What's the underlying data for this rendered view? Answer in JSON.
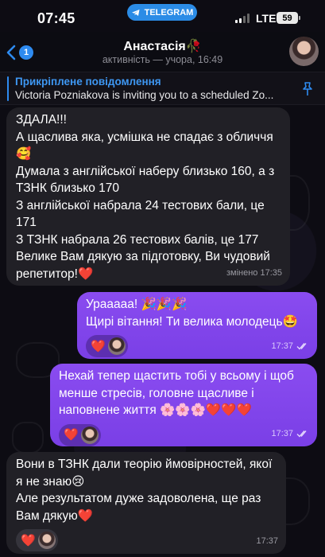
{
  "status_bar": {
    "time": "07:45",
    "app_pill": "TELEGRAM",
    "network": "LTE",
    "battery": "59"
  },
  "header": {
    "back_count": "1",
    "title": "Анастасія🥀",
    "subtitle": "активність — учора, 16:49"
  },
  "pinned": {
    "title": "Прикріплене повідомлення",
    "text": "Victoria Pozniakova is inviting you to a scheduled Zo..."
  },
  "messages": [
    {
      "direction": "incoming",
      "text": "ЗДАЛА!!!\nА щаслива яка, усмішка не спадає з обличчя🥰\nДумала з англійської наберу близько 160, а з ТЗНК близько 170\nЗ англійської набрала 24 тестових бали, це 171\nЗ ТЗНК набрала 26 тестових балів, це 177\nВелике Вам дякую за підготовку, Ви чудовий репетитор!❤️",
      "meta": "змінено 17:35"
    },
    {
      "direction": "outgoing",
      "text": "Урааааа! 🎉🎉🎉\nЩирі вітання! Ти велика молодець🤩",
      "meta": "17:37",
      "reaction": "❤️"
    },
    {
      "direction": "outgoing",
      "text": "Нехай тепер щастить тобі у всьому і щоб менше стресів, головне щасливе і наповнене життя 🌸🌸🌸❤️❤️❤️",
      "meta": "17:37",
      "reaction": "❤️"
    },
    {
      "direction": "incoming",
      "text": "Вони в ТЗНК дали теорію ймовірностей, якої я не знаю😢\nАле результатом дуже задоволена, ще раз Вам дякую❤️",
      "meta": "17:37",
      "reaction": "❤️"
    }
  ]
}
